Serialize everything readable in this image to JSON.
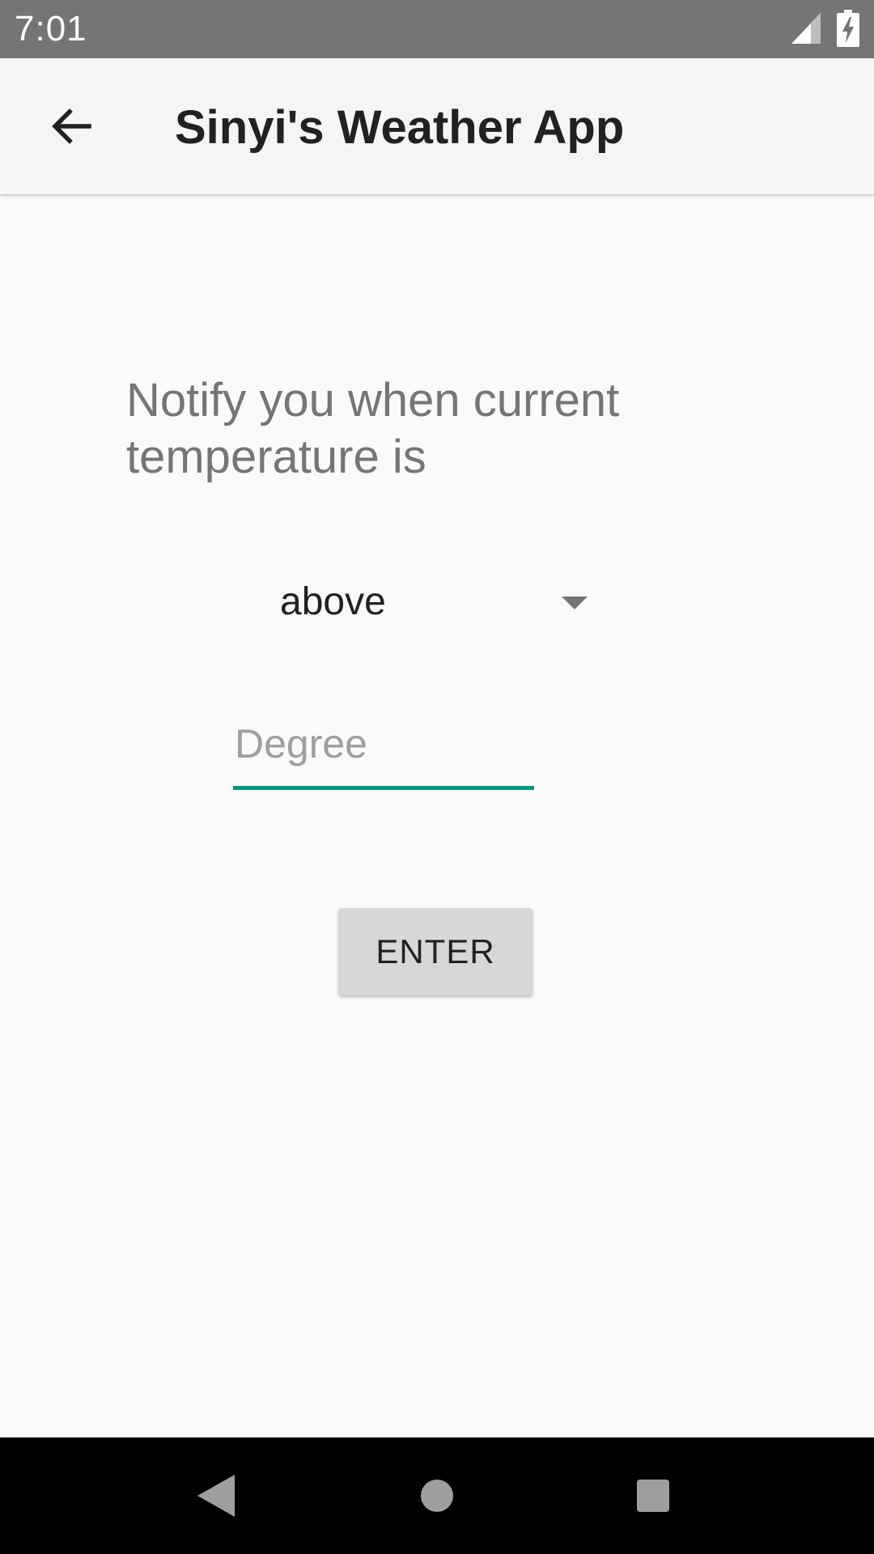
{
  "status_bar": {
    "time": "7:01",
    "icons": [
      "signal-icon",
      "battery-charging-icon"
    ]
  },
  "app_bar": {
    "back_icon": "arrow-left-icon",
    "title": "Sinyi's Weather App"
  },
  "main": {
    "prompt": "Notify you when current temperature is",
    "condition_select": {
      "selected": "above"
    },
    "degree_input": {
      "value": "",
      "placeholder": "Degree"
    },
    "enter_button_label": "ENTER"
  },
  "nav_bar": {
    "icons": [
      "nav-back-icon",
      "nav-home-icon",
      "nav-recents-icon"
    ]
  },
  "colors": {
    "status_bar": "#757575",
    "app_bar": "#f5f5f5",
    "background": "#fafafa",
    "accent": "#009688",
    "button": "#d6d7d7",
    "nav_bar": "#000000"
  }
}
